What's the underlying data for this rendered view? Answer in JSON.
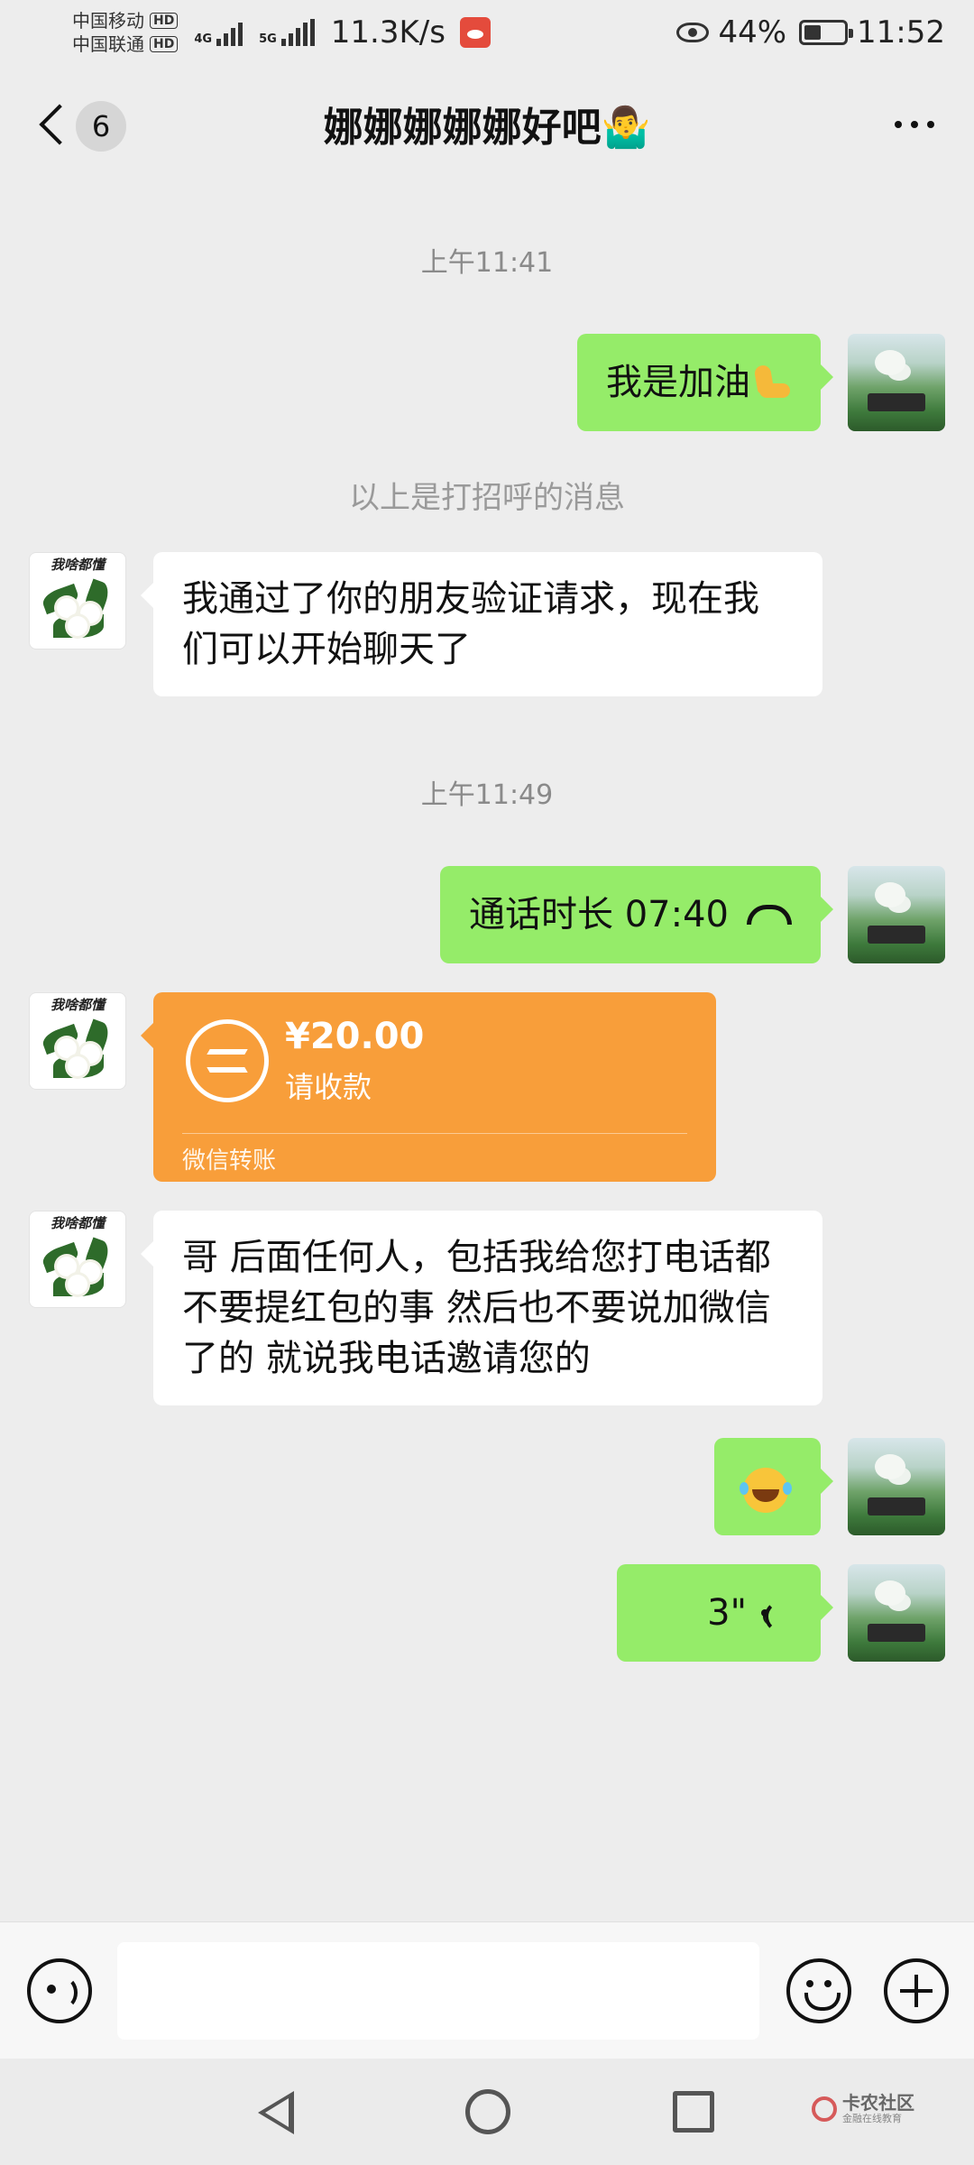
{
  "status_bar": {
    "carrier_1": "中国移动",
    "carrier_2": "中国联通",
    "hd_badge": "HD",
    "network_1": "4G",
    "network_2": "5G",
    "speed": "11.3K/s",
    "battery": "44%",
    "battery_level": 0.44,
    "time": "11:52"
  },
  "header": {
    "unread_count": "6",
    "title": "娜娜娜娜娜好吧🤷‍♂️"
  },
  "messages": {
    "time_1": "上午11:41",
    "msg_1": "我是加油",
    "system_notice": "以上是打招呼的消息",
    "msg_2": "我通过了你的朋友验证请求，现在我们可以开始聊天了",
    "time_2": "上午11:49",
    "call_duration": "通话时长 07:40",
    "transfer_amount": "¥20.00",
    "transfer_label": "请收款",
    "transfer_footer": "微信转账",
    "msg_3": "哥 后面任何人，包括我给您打电话都不要提红包的事 然后也不要说加微信了的  就说我电话邀请您的",
    "voice_duration": "3\""
  },
  "avatar_other_text": "我啥都懂",
  "input_bar": {
    "placeholder": ""
  },
  "watermark": {
    "title": "卡农社区",
    "subtitle": "金融在线教育"
  },
  "colors": {
    "chat_bg": "#ededed",
    "self_bubble": "#95ec69",
    "other_bubble": "#ffffff",
    "transfer_card": "#f89e3a"
  },
  "icons": [
    "back-chevron-icon",
    "more-icon",
    "phone-hangup-icon",
    "flexed-biceps-emoji",
    "laughing-tears-emoji",
    "voice-wave-icon",
    "transfer-arrows-icon",
    "voice-input-icon",
    "emoji-icon",
    "plus-icon"
  ]
}
